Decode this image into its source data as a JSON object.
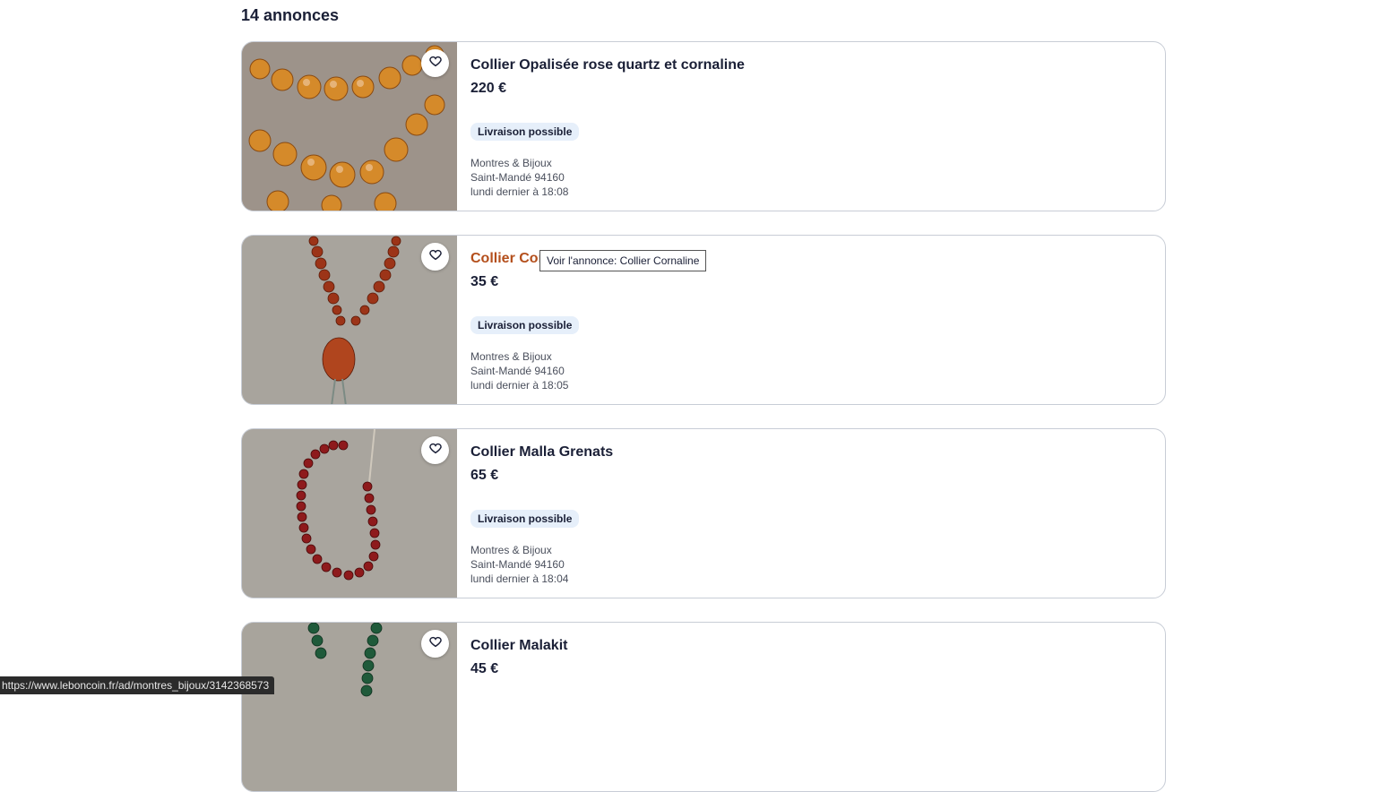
{
  "results": {
    "count_label": "14 annonces"
  },
  "listings": [
    {
      "title": "Collier Opalisée rose quartz et cornaline",
      "price": "220 €",
      "badge": "Livraison possible",
      "category": "Montres & Bijoux",
      "location": "Saint-Mandé 94160",
      "date": "lundi dernier à 18:08",
      "image_icon": "amber-bead-necklace-photo"
    },
    {
      "title": "Collier Cornaline",
      "title_visible": "Collier Cor",
      "price": "35 €",
      "badge": "Livraison possible",
      "category": "Montres & Bijoux",
      "location": "Saint-Mandé 94160",
      "date": "lundi dernier à 18:05",
      "image_icon": "carnelian-pendant-necklace-photo"
    },
    {
      "title": "Collier Malla Grenats",
      "price": "65 €",
      "badge": "Livraison possible",
      "category": "Montres & Bijoux",
      "location": "Saint-Mandé 94160",
      "date": "lundi dernier à 18:04",
      "image_icon": "garnet-mala-necklace-photo"
    },
    {
      "title": "Collier Malakit",
      "price": "45 €",
      "image_icon": "malachite-necklace-photo"
    }
  ],
  "tooltip": {
    "text": "Voir l'annonce: Collier Cornaline"
  },
  "status_bar": {
    "url": "https://www.leboncoin.fr/ad/montres_bijoux/3142368573"
  },
  "colors": {
    "title": "#1a1f36",
    "title_hover": "#b44f1c",
    "badge_bg": "#e6effa",
    "card_border": "#c8cdd6"
  }
}
